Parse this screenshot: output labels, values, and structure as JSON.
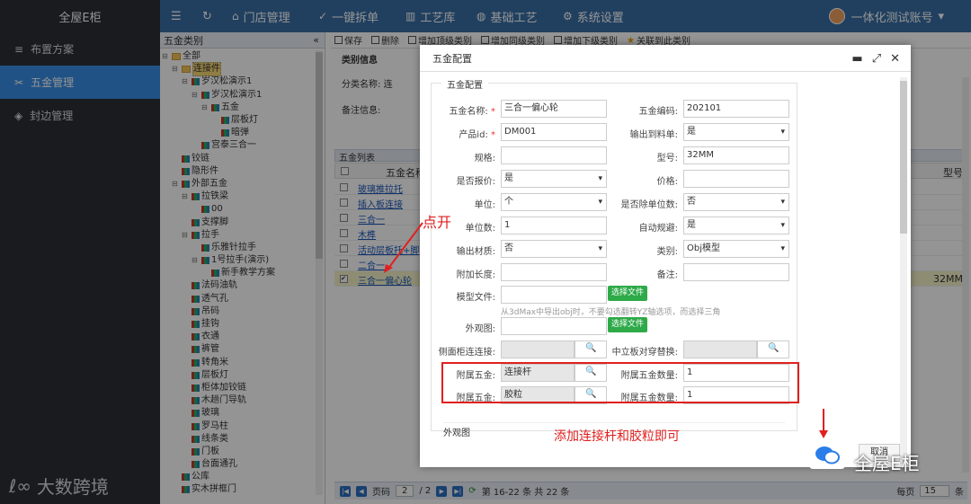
{
  "app": {
    "logo_text": "全屋E柜"
  },
  "topnav": [
    {
      "label": "",
      "icon": "menu-icon"
    },
    {
      "label": "",
      "icon": "refresh-icon"
    },
    {
      "label": "门店管理",
      "icon": "home-icon"
    },
    {
      "label": "一键拆单",
      "icon": "check-circle-icon"
    },
    {
      "label": "工艺库",
      "icon": "bar-chart-icon"
    },
    {
      "label": "基础工艺",
      "icon": "palette-icon"
    },
    {
      "label": "系统设置",
      "icon": "gear-icon"
    }
  ],
  "user": {
    "name": "一体化测试账号"
  },
  "sidebar": [
    {
      "label": "布置方案",
      "icon": "sliders-icon"
    },
    {
      "label": "五金管理",
      "icon": "tools-icon"
    },
    {
      "label": "封边管理",
      "icon": "layers-icon"
    }
  ],
  "watermark": "大数跨境",
  "tree": {
    "title": "五金类别",
    "nodes": [
      "全部",
      "连接件",
      "岁汉松演示1",
      "岁汉松演示1",
      "五金",
      "层板灯",
      "暗弹",
      "宫泰三合一",
      "铰链",
      "隐形件",
      "外部五金",
      "拉铁梁",
      "00",
      "支撑脚",
      "拉手",
      "乐雅针拉手",
      "1号拉手(演示)",
      "新手教学方案",
      "法码油轨",
      "透气孔",
      "吊码",
      "挂钩",
      "衣通",
      "裤管",
      "转角米",
      "层板灯",
      "柜体加铰链",
      "木趟门导轨",
      "玻璃",
      "罗马柱",
      "线条类",
      "门板",
      "台面通孔",
      "公库",
      "实木拼框门"
    ]
  },
  "toolbar": [
    "保存",
    "删除",
    "增加顶级类别",
    "增加同级类别",
    "增加下级类别",
    "关联到此类别"
  ],
  "catinfo": {
    "title": "类别信息",
    "name_label": "分类名称:",
    "name_value": "连",
    "note_label": "备注信息:"
  },
  "list": {
    "title": "五金列表",
    "col_name": "五金名称",
    "col_model": "型号",
    "rows": [
      "玻璃推拉托",
      "插入板连接",
      "三合一",
      "木榫",
      "活动层板托+脚",
      "二合一",
      "三合一偏心轮"
    ],
    "selected_model": "32MM"
  },
  "pager": {
    "page_label": "页码",
    "page": "2",
    "total_pages": "/ 2",
    "summary": "第 16-22 条  共 22 条",
    "per_page_label": "每页",
    "per_page": "15",
    "suffix": "条"
  },
  "dialog": {
    "title": "五金配置",
    "legend": "五金配置",
    "fields": {
      "name_label": "五金名称:",
      "name_value": "三合一偏心轮",
      "code_label": "五金编码:",
      "code_value": "202101",
      "product_label": "产品id:",
      "product_value": "DM001",
      "output_label": "输出到料单:",
      "output_value": "是",
      "spec_label": "规格:",
      "spec_value": "",
      "model_label": "型号:",
      "model_value": "32MM",
      "quote_label": "是否报价:",
      "quote_value": "是",
      "price_label": "价格:",
      "price_value": "",
      "unit_label": "单位:",
      "unit_value": "个",
      "except_label": "是否除单位数:",
      "except_value": "否",
      "unitnum_label": "单位数:",
      "unitnum_value": "1",
      "auto_label": "自动规避:",
      "auto_value": "是",
      "material_label": "输出材质:",
      "material_value": "否",
      "category_label": "类别:",
      "category_value": "Obj模型",
      "extra_label": "附加长度:",
      "extra_value": "",
      "remark_label": "备注:",
      "remark_value": "",
      "modelfile_label": "模型文件:",
      "choose_file": "选择文件",
      "hint": "从3dMax中导出obj时，不要勾选翻转YZ轴选项，而选择三角",
      "appearance_label": "外观图:",
      "choose_file2": "选择文件",
      "side_label": "侧面柜连连接:",
      "mid_label": "中立板对穿替换:",
      "attach_label": "附属五金:",
      "attach_value": "连接杆",
      "attach_qty_label": "附属五金数量:",
      "attach_qty_value": "1",
      "attach2_label": "附属五金:",
      "attach2_value": "胶粒",
      "attach2_qty_label": "附属五金数量:",
      "attach2_qty_value": "1",
      "section2": "外观图"
    },
    "cancel": "取消"
  },
  "annotations": {
    "click_open": "点开",
    "add_hint": "添加连接杆和胶粒即可"
  },
  "brand_overlay": "全屋E柜",
  "colors": {
    "topbar": "#3a6fa6",
    "sidebar": "#2b2f36",
    "active": "#3a8ee6",
    "annotation": "#e02020",
    "green_button": "#2eaa49"
  }
}
